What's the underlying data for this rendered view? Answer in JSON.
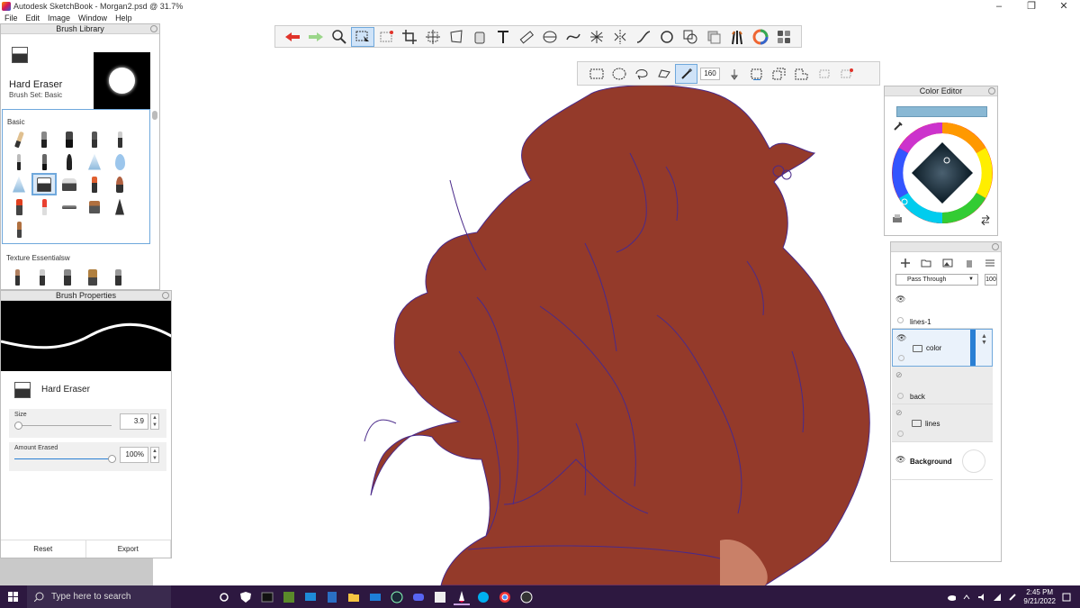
{
  "window": {
    "title": "Autodesk SketchBook - Morgan2.psd @ 31.7%",
    "controls": [
      "–",
      "❐",
      "✕"
    ]
  },
  "menu": [
    "File",
    "Edit",
    "Image",
    "Window",
    "Help"
  ],
  "brush_library": {
    "title": "Brush Library",
    "current_brush": "Hard Eraser",
    "brush_set": "Brush Set: Basic",
    "section_basic": "Basic",
    "section_texture": "Texture Essentialsw"
  },
  "brush_properties": {
    "title": "Brush Properties",
    "brush_name": "Hard Eraser",
    "size_label": "Size",
    "size_value": "3.9",
    "size_fraction": 0.04,
    "amount_label": "Amount Erased",
    "amount_value": "100%",
    "amount_fraction": 1.0,
    "reset_label": "Reset",
    "export_label": "Export"
  },
  "selection_toolbar": {
    "value": "160"
  },
  "color_editor": {
    "title": "Color Editor",
    "current_color": "#89b8d4"
  },
  "layers": {
    "blend_mode": "Pass Through",
    "opacity": "100",
    "items": [
      {
        "name": "lines-1"
      },
      {
        "name": "color"
      },
      {
        "name": "back"
      },
      {
        "name": "lines"
      },
      {
        "name": "Background"
      }
    ]
  },
  "colors": {
    "artwork_fill": "#943a2a",
    "line_color": "#4a2a8a",
    "selection_accent": "#6fa8dc",
    "taskbar_bg": "#2d1840"
  },
  "taskbar": {
    "search_placeholder": "Type here to search",
    "time": "2:45 PM",
    "date": "9/21/2022"
  }
}
